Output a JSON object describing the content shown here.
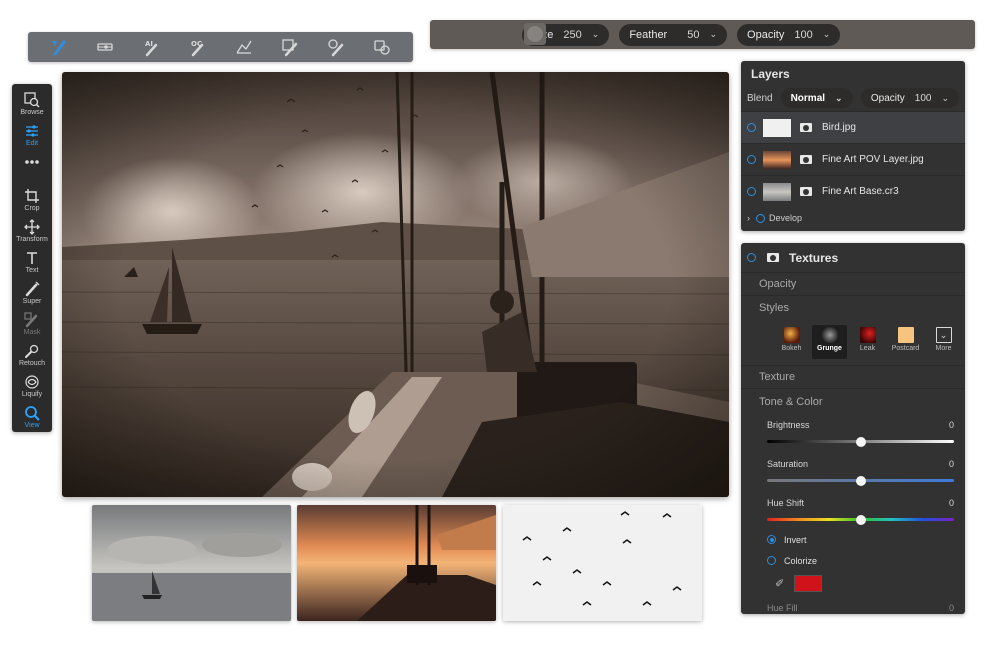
{
  "toolbar": {
    "tools": [
      {
        "icon": "brush-paint-icon",
        "active": true
      },
      {
        "icon": "eraser-line-icon",
        "active": false
      },
      {
        "icon": "ai-brush-icon",
        "text": "AI",
        "active": false
      },
      {
        "icon": "oc-brush-icon",
        "text": "OC",
        "active": false
      },
      {
        "icon": "gradient-mask-icon",
        "active": false
      },
      {
        "icon": "paint-bucket-icon",
        "active": false
      },
      {
        "icon": "color-brush-icon",
        "active": false
      },
      {
        "icon": "refine-brush-icon",
        "active": false
      }
    ]
  },
  "optbar": {
    "size_label": "Size",
    "size_value": "250",
    "feather_label": "Feather",
    "feather_value": "50",
    "opacity_label": "Opacity",
    "opacity_value": "100"
  },
  "leftpanel": {
    "tools": [
      {
        "label": "Browse",
        "icon": "browse-icon",
        "state": "normal"
      },
      {
        "label": "Edit",
        "icon": "edit-sliders-icon",
        "state": "active"
      },
      {
        "label": "",
        "icon": "more-dots-icon",
        "state": "normal"
      },
      {
        "label": "Crop",
        "icon": "crop-icon",
        "state": "normal"
      },
      {
        "label": "Transform",
        "icon": "transform-icon",
        "state": "normal"
      },
      {
        "label": "Text",
        "icon": "text-icon",
        "state": "normal"
      },
      {
        "label": "Super",
        "icon": "super-brush-icon",
        "state": "normal"
      },
      {
        "label": "Mask",
        "icon": "mask-brush-icon",
        "state": "dim"
      },
      {
        "label": "Retouch",
        "icon": "retouch-icon",
        "state": "normal"
      },
      {
        "label": "Liquify",
        "icon": "liquify-icon",
        "state": "normal"
      },
      {
        "label": "View",
        "icon": "view-zoom-icon",
        "state": "active"
      }
    ]
  },
  "layers": {
    "title": "Layers",
    "blend_label": "Blend",
    "blend_value": "Normal",
    "opacity_label": "Opacity",
    "opacity_value": "100",
    "items": [
      {
        "name": "Bird.jpg",
        "selected": true
      },
      {
        "name": "Fine Art POV Layer.jpg",
        "selected": false
      },
      {
        "name": "Fine Art Base.cr3",
        "selected": false
      }
    ],
    "develop_label": "Develop"
  },
  "textures": {
    "title": "Textures",
    "opacity_label": "Opacity",
    "styles_label": "Styles",
    "styles": [
      {
        "name": "Bokeh",
        "selected": false
      },
      {
        "name": "Grunge",
        "selected": true
      },
      {
        "name": "Leak",
        "selected": false
      },
      {
        "name": "Postcard",
        "selected": false
      },
      {
        "name": "More",
        "selected": false
      }
    ],
    "texture_label": "Texture",
    "tone_color_label": "Tone & Color",
    "sliders": [
      {
        "label": "Brightness",
        "value": "0",
        "fraction": 0.5
      },
      {
        "label": "Saturation",
        "value": "0",
        "fraction": 0.5
      },
      {
        "label": "Hue Shift",
        "value": "0",
        "fraction": 0.5
      }
    ],
    "invert_label": "Invert",
    "colorize_label": "Colorize",
    "colorize_swatch": "#d0121b",
    "hue_fill_label": "Hue Fill",
    "hue_fill_value": "0"
  },
  "colors": {
    "accent": "#2e8fe0",
    "panel": "#323232",
    "selected_row": "#3f4044"
  }
}
